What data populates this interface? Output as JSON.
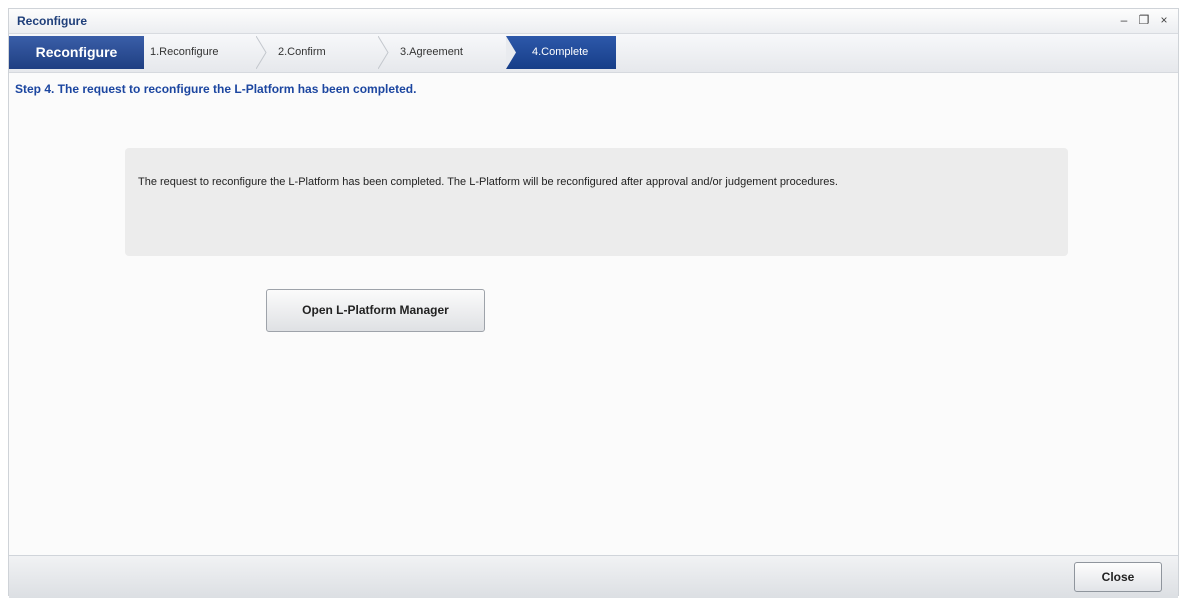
{
  "window": {
    "title": "Reconfigure",
    "controls": {
      "minimize": "–",
      "restore": "❐",
      "close": "×"
    }
  },
  "wizard": {
    "title": "Reconfigure",
    "steps": [
      {
        "label": "1.Reconfigure",
        "active": false
      },
      {
        "label": "2.Confirm",
        "active": false
      },
      {
        "label": "3.Agreement",
        "active": false
      },
      {
        "label": "4.Complete",
        "active": true
      }
    ],
    "colors": {
      "accent": "#1f3f82",
      "active_step": "#173e88"
    }
  },
  "main": {
    "heading": "Step 4. The request to reconfigure the L-Platform has been completed.",
    "message": "The request to reconfigure the L-Platform has been completed. The L-Platform will be reconfigured after approval and/or judgement procedures.",
    "open_button": "Open L-Platform Manager"
  },
  "footer": {
    "close_button": "Close"
  }
}
